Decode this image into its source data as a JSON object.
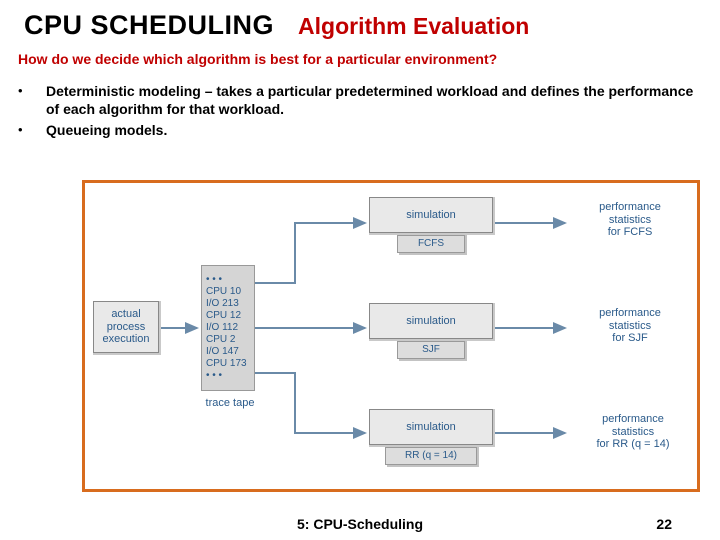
{
  "header": {
    "title": "CPU SCHEDULING",
    "subtitle": "Algorithm Evaluation"
  },
  "question": "How do we decide which algorithm is best for a particular environment?",
  "bullets": [
    "Deterministic modeling – takes a particular predetermined workload and defines the performance of each algorithm  for that workload.",
    "Queueing models."
  ],
  "diagram": {
    "actual_process": "actual\nprocess\nexecution",
    "tape_lines": [
      "• • •",
      "CPU  10",
      "I/O   213",
      "CPU  12",
      "I/O   112",
      "CPU   2",
      "I/O   147",
      "CPU 173",
      "• • •"
    ],
    "trace_tape_label": "trace tape",
    "sim_label": "simulation",
    "algo_fcfs": "FCFS",
    "algo_sjf": "SJF",
    "algo_rr": "RR (q = 14)",
    "perf_fcfs": "performance\nstatistics\nfor FCFS",
    "perf_sjf": "performance\nstatistics\nfor SJF",
    "perf_rr": "performance\nstatistics\nfor RR (q = 14)"
  },
  "footer": {
    "center": "5: CPU-Scheduling",
    "page": "22"
  }
}
